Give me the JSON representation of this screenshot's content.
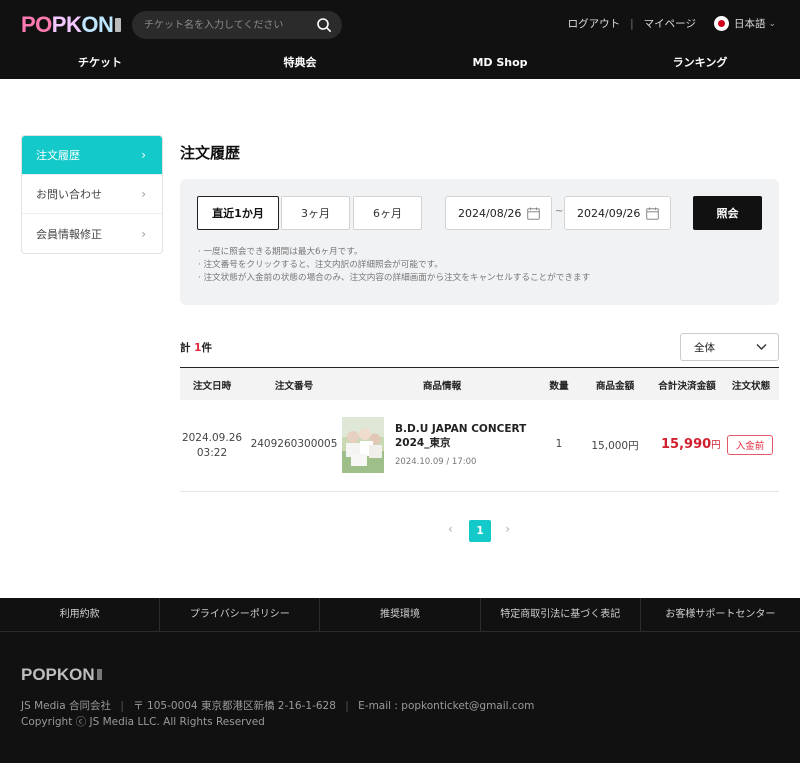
{
  "header": {
    "logo": "POPKON",
    "search_placeholder": "チケット名を入力してください",
    "logout": "ログアウト",
    "separator": "|",
    "mypage": "マイページ",
    "language": "日本語",
    "nav": [
      "チケット",
      "特典会",
      "MD Shop",
      "ランキング"
    ]
  },
  "sidebar": {
    "items": [
      {
        "label": "注文履歴",
        "active": true
      },
      {
        "label": "お問い合わせ",
        "active": false
      },
      {
        "label": "会員情報修正",
        "active": false
      }
    ]
  },
  "page_title": "注文履歴",
  "filter": {
    "periods": [
      "直近1か月",
      "3ヶ月",
      "6ヶ月"
    ],
    "active_period": "直近1か月",
    "date_from": "2024/08/26",
    "date_to": "2024/09/26",
    "range_sep": "~",
    "query_button": "照会",
    "notes": [
      "· 一度に照会できる期間は最大6ヶ月です。",
      "· 注文番号をクリックすると、注文内訳の詳細照会が可能です。",
      "· 注文状態が入金前の状態の場合のみ、注文内容の詳細画面から注文をキャンセルすることができます"
    ]
  },
  "summary": {
    "prefix": "計",
    "count": "1",
    "suffix": "件",
    "filter_value": "全体"
  },
  "table": {
    "headers": [
      "注文日時",
      "注文番号",
      "商品情報",
      "数量",
      "商品金額",
      "合計決済金額",
      "注文状態"
    ],
    "rows": [
      {
        "date": "2024.09.26",
        "time": "03:22",
        "order_no": "2409260300005",
        "product_line1": "B.D.U JAPAN CONCERT",
        "product_line2": "2024_東京",
        "event_datetime": "2024.10.09 / 17:00",
        "quantity": "1",
        "price": "15,000円",
        "total": "15,990",
        "total_unit": "円",
        "status": "入金前"
      }
    ]
  },
  "pagination": {
    "prev": "‹",
    "current": "1",
    "next": "›"
  },
  "footer": {
    "links": [
      "利用約款",
      "プライバシーポリシー",
      "推奨環境",
      "特定商取引法に基づく表記",
      "お客様サポートセンター"
    ],
    "logo": "POPKON",
    "company": "JS Media 合同会社",
    "address": "〒 105-0004 東京都港区新橋 2-16-1-628",
    "email": "E-mail : popkonticket@gmail.com",
    "copyright": "Copyright ⓒ JS Media LLC. All Rights Reserved",
    "separator": "|"
  },
  "colors": {
    "accent": "#13c9c9",
    "price_red": "#d0202f",
    "dark": "#111111"
  }
}
